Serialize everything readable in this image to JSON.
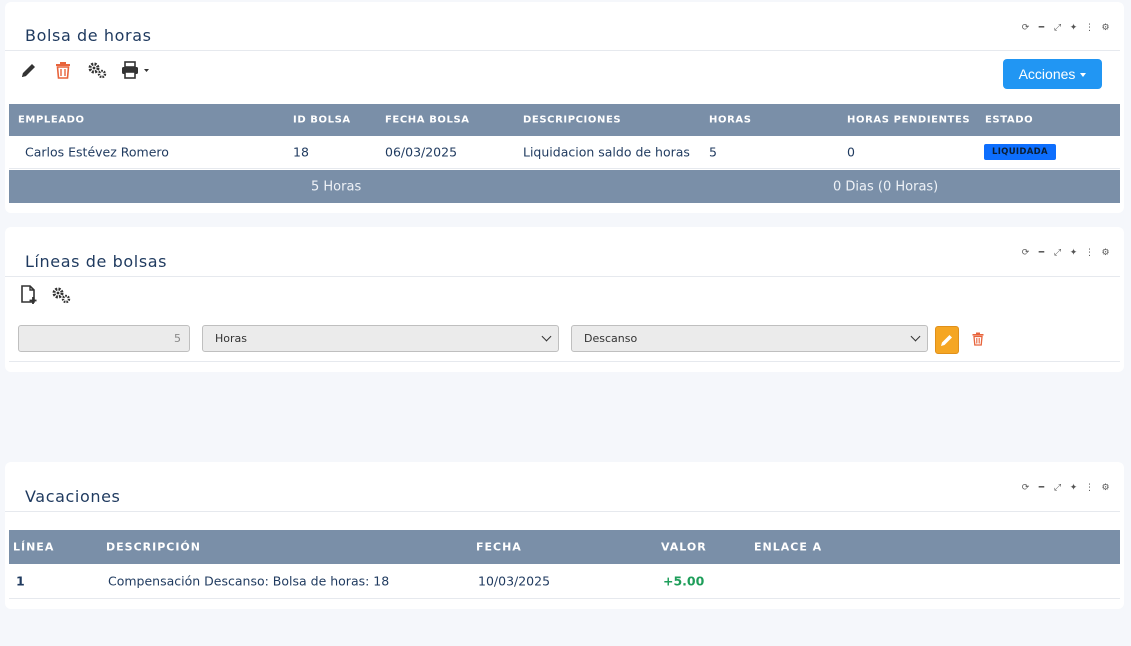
{
  "window_tools": {
    "refresh": "refresh-icon",
    "minimize": "minimize-icon",
    "expand": "expand-icon",
    "magic": "magic-wand-icon",
    "more": "more-icon",
    "settings": "gear-icon"
  },
  "bolsa": {
    "title": "Bolsa de horas",
    "actions_label": "Acciones",
    "columns": [
      "EMPLEADO",
      "ID BOLSA",
      "FECHA BOLSA",
      "DESCRIPCIONES",
      "HORAS",
      "HORAS PENDIENTES",
      "ESTADO"
    ],
    "row": {
      "empleado": "Carlos Estévez Romero",
      "id": "18",
      "fecha": "06/03/2025",
      "descripcion": "Liquidacion saldo de horas",
      "horas": "5",
      "pendientes": "0",
      "estado": "LIQUIDADA"
    },
    "footer": {
      "horas_total": "5 Horas",
      "dias_total": "0 Dias (0 Horas)"
    }
  },
  "lineas": {
    "title": "Líneas de bolsas",
    "quantity_value": "5",
    "unit_selected": "Horas",
    "type_selected": "Descanso"
  },
  "vacaciones": {
    "title": "Vacaciones",
    "columns": [
      "LÍNEA",
      "DESCRIPCIÓN",
      "FECHA",
      "VALOR",
      "ENLACE A"
    ],
    "row": {
      "linea": "1",
      "descripcion": "Compensación Descanso: Bolsa de horas: 18",
      "fecha": "10/03/2025",
      "valor": "+5.00",
      "enlace": ""
    }
  },
  "colors": {
    "accent": "#2196f3",
    "header": "#7a8fa8",
    "badge": "#0d6efd",
    "edit": "#f5a623",
    "delete": "#e8643c",
    "positive": "#1e9e5a"
  }
}
